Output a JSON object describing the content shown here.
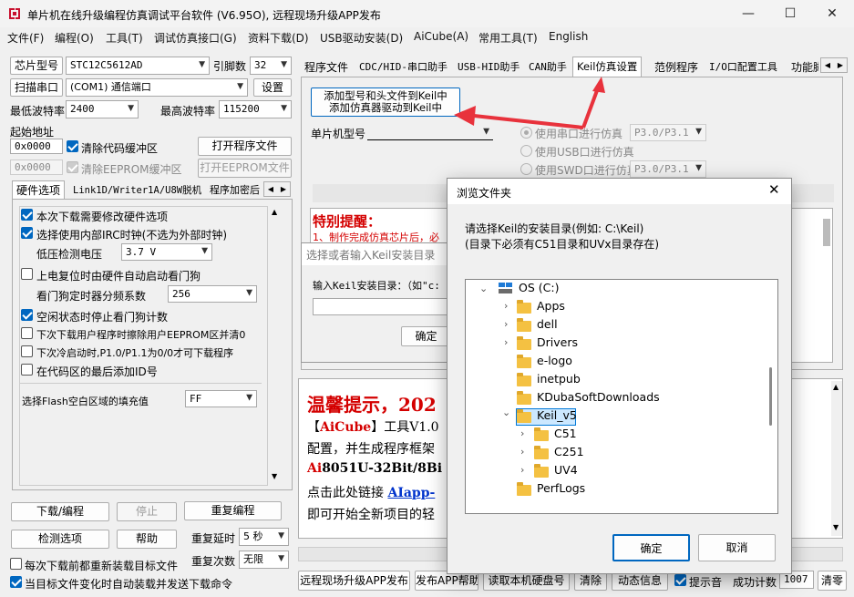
{
  "window": {
    "title": "单片机在线升级编程仿真调试平台软件 (V6.95O), 远程现场升级APP发布",
    "minimize": "—",
    "maximize": "☐",
    "close": "✕"
  },
  "menu": [
    "文件(F)",
    "编程(O)",
    "工具(T)",
    "调试仿真接口(G)",
    "资料下载(D)",
    "USB驱动安装(D)",
    "AiCube(A)",
    "常用工具(T)",
    "English"
  ],
  "left": {
    "chip_label": "芯片型号",
    "chip_value": "STC12C5612AD",
    "pins_label": "引脚数",
    "pins_value": "32",
    "scan_port": "扫描串口",
    "port_value": "(COM1) 通信端口",
    "settings": "设置",
    "min_baud_label": "最低波特率",
    "min_baud": "2400",
    "max_baud_label": "最高波特率",
    "max_baud": "115200",
    "start_addr_label": "起始地址",
    "addr1": "0x0000",
    "clear_code": "清除代码缓冲区",
    "open_program": "打开程序文件",
    "addr2": "0x0000",
    "clear_eeprom": "清除EEPROM缓冲区",
    "open_eeprom": "打开EEPROM文件",
    "tabs": [
      "硬件选项",
      "Link1D/Writer1A/U8W脱机",
      "程序加密后"
    ],
    "options": [
      "本次下载需要修改硬件选项",
      "选择使用内部IRC时钟(不选为外部时钟)",
      "低压检测电压",
      "上电复位时由硬件自动启动看门狗",
      "看门狗定时器分频系数",
      "空闲状态时停止看门狗计数",
      "下次下载用户程序时擦除用户EEPROM区并清0",
      "下次冷启动时,P1.0/P1.1为0/0才可下载程序",
      "在代码区的最后添加ID号",
      "选择Flash空白区域的填充值"
    ],
    "voltage": "3.7 V",
    "divider": "256",
    "fill": "FF",
    "download": "下载/编程",
    "stop": "停止",
    "reprogram": "重复编程",
    "detect": "检测选项",
    "help": "帮助",
    "repeat_delay_label": "重复延时",
    "repeat_delay": "5 秒",
    "repeat_count_label": "重复次数",
    "repeat_count": "无限",
    "reload_each": "每次下载前都重新装载目标文件",
    "auto_reload": "当目标文件变化时自动装载并发送下载命令"
  },
  "right": {
    "tabs": [
      "程序文件",
      "CDC/HID-串口助手",
      "USB-HID助手",
      "CAN助手",
      "Keil仿真设置",
      "范例程序",
      "I/O口配置工具",
      "功能脚"
    ],
    "add_keil_line1": "添加型号和头文件到Keil中",
    "add_keil_line2": "添加仿真器驱动到Keil中",
    "mcu_model_label": "单片机型号",
    "uart_sim": "使用串口进行仿真",
    "uart_port": "P3.0/P3.1",
    "usb_sim": "使用USB口进行仿真",
    "swd_sim": "使用SWD口进行仿真",
    "swd_port": "P3.0/P3.1",
    "notice_title": "特别提醒：",
    "notice_line": "1、制作完成仿真芯片后，必",
    "tip_title": "温馨提示，202",
    "tip_l1a": "【",
    "tip_l1b": "AiCube",
    "tip_l1c": "】工具V1.0",
    "tip_l2": "配置，并生成程序框架",
    "tip_l3a": "Ai",
    "tip_l3b": "8051U-32Bit/8Bi",
    "tip_l4a": "点击此处链接 ",
    "tip_l4b": "AIapp-",
    "tip_l5": "即可开始全新项目的轻",
    "bottom": [
      "远程现场升级APP发布",
      "发布APP帮助",
      "读取本机硬盘号",
      "清除",
      "动态信息",
      "提示音",
      "成功计数",
      "1007",
      "清零"
    ]
  },
  "keil_dialog": {
    "title": "选择或者输入Keil安装目录",
    "label": "输入Keil安装目录：（如\"c:",
    "ok": "确定"
  },
  "browse": {
    "title": "浏览文件夹",
    "desc1": "请选择Keil的安装目录(例如: C:\\Keil)",
    "desc2": "(目录下必须有C51目录和UVx目录存在)",
    "tree": [
      "OS (C:)",
      "Apps",
      "dell",
      "Drivers",
      "e-logo",
      "inetpub",
      "KDubaSoftDownloads",
      "Keil_v5",
      "C51",
      "C251",
      "UV4",
      "PerfLogs"
    ],
    "ok": "确定",
    "cancel": "取消"
  },
  "colors": {
    "accent": "#0067c0",
    "red": "#d40000",
    "arrow": "#e8323c"
  }
}
